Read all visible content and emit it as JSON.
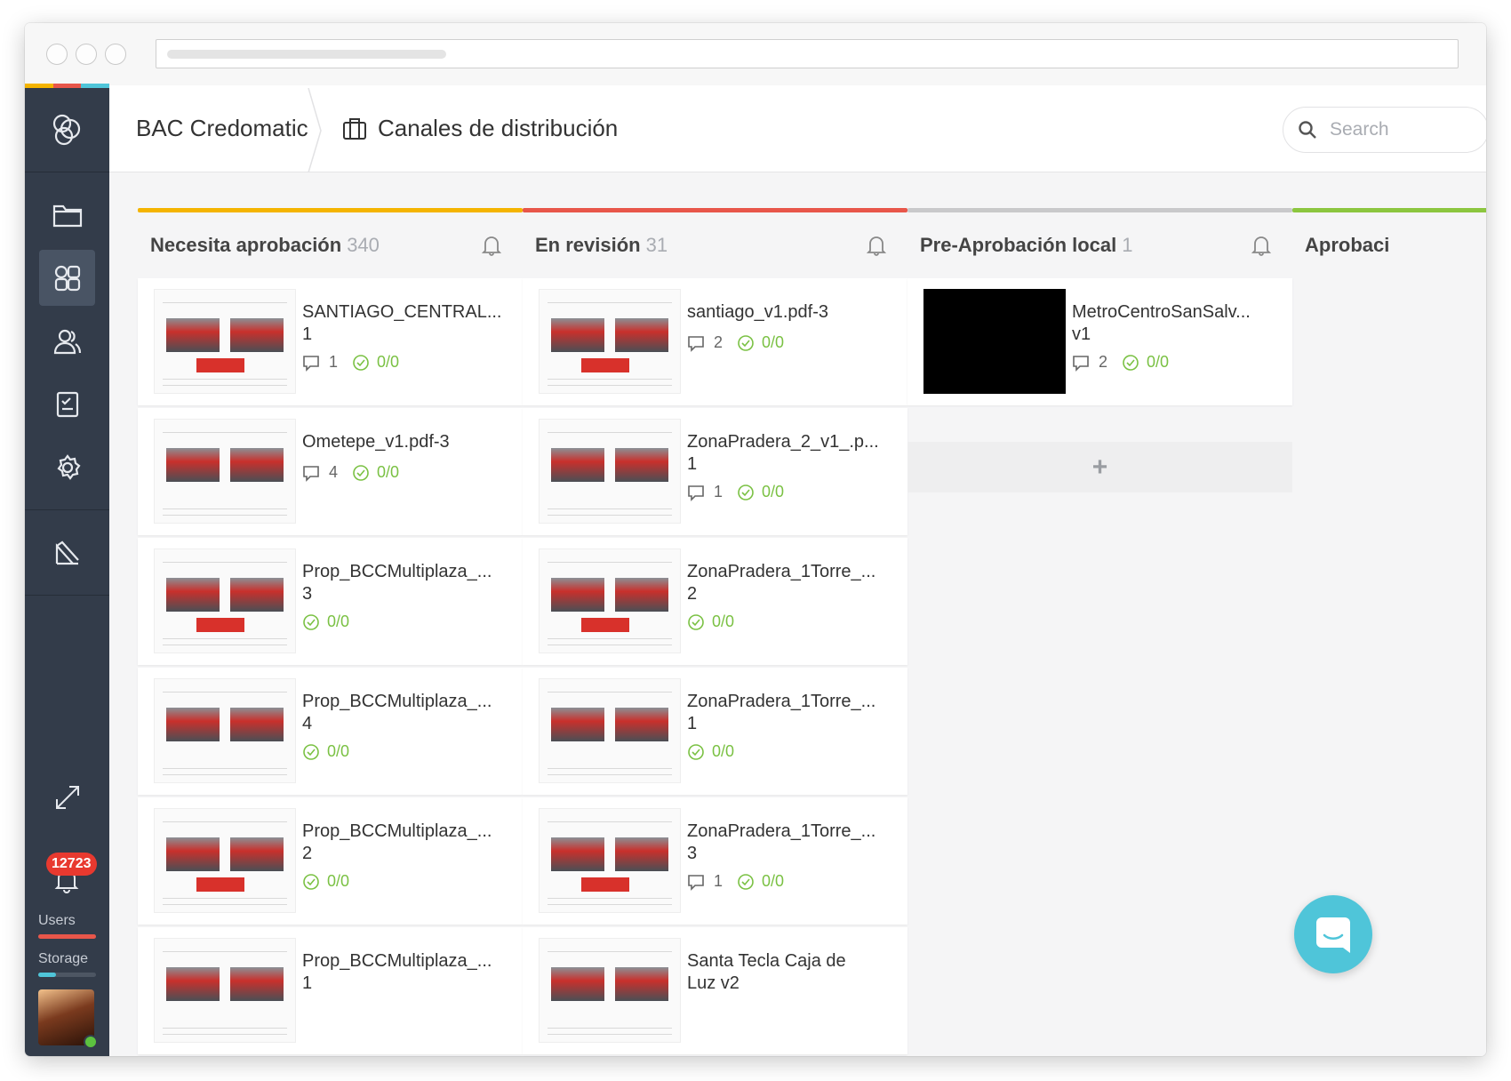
{
  "header": {
    "workspace": "BAC Credomatic",
    "project": "Canales de distribución",
    "search_placeholder": "Search"
  },
  "sidebar": {
    "notification_count": "12723",
    "users_label": "Users",
    "users_usage": 1.0,
    "storage_label": "Storage",
    "storage_usage": 0.3
  },
  "colors": {
    "col1": "#f4b400",
    "col2": "#e8564a",
    "col3": "#c9c9cb",
    "col4": "#8cc63f",
    "users_meter": "#e8564a",
    "storage_meter": "#4fc5d9",
    "check": "#7ac143"
  },
  "columns": [
    {
      "title": "Necesita aprobación",
      "count": "340",
      "cards": [
        {
          "title": "SANTIAGO_CENTRAL...",
          "version": "1",
          "comments": "1",
          "tasks": "0/0"
        },
        {
          "title": "Ometepe_v1.pdf-3",
          "version": "",
          "comments": "4",
          "tasks": "0/0"
        },
        {
          "title": "Prop_BCCMultiplaza_...",
          "version": "3",
          "comments": "",
          "tasks": "0/0"
        },
        {
          "title": "Prop_BCCMultiplaza_...",
          "version": "4",
          "comments": "",
          "tasks": "0/0"
        },
        {
          "title": "Prop_BCCMultiplaza_...",
          "version": "2",
          "comments": "",
          "tasks": "0/0"
        },
        {
          "title": "Prop_BCCMultiplaza_...",
          "version": "1",
          "comments": "",
          "tasks": ""
        }
      ]
    },
    {
      "title": "En revisión",
      "count": "31",
      "cards": [
        {
          "title": "santiago_v1.pdf-3",
          "version": "",
          "comments": "2",
          "tasks": "0/0"
        },
        {
          "title": "ZonaPradera_2_v1_.p...",
          "version": "1",
          "comments": "1",
          "tasks": "0/0"
        },
        {
          "title": "ZonaPradera_1Torre_...",
          "version": "2",
          "comments": "",
          "tasks": "0/0"
        },
        {
          "title": "ZonaPradera_1Torre_...",
          "version": "1",
          "comments": "",
          "tasks": "0/0"
        },
        {
          "title": "ZonaPradera_1Torre_...",
          "version": "3",
          "comments": "1",
          "tasks": "0/0"
        },
        {
          "title": "Santa Tecla Caja de",
          "version": "Luz v2",
          "comments": "",
          "tasks": ""
        }
      ]
    },
    {
      "title": "Pre-Aprobación local",
      "count": "1",
      "cards": [
        {
          "title": "MetroCentroSanSalv...",
          "version": "v1",
          "comments": "2",
          "tasks": "0/0"
        }
      ],
      "add_label": "+"
    },
    {
      "title": "Aprobaci",
      "count": "",
      "cards": []
    }
  ]
}
